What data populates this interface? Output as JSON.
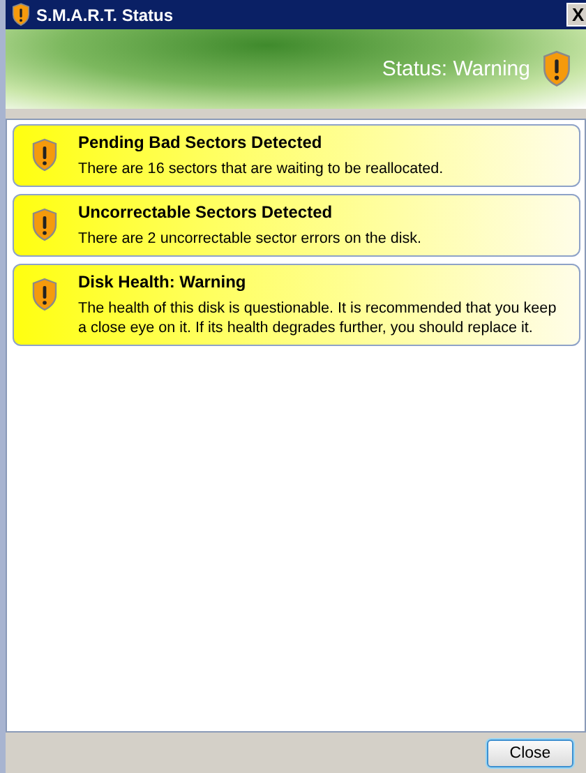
{
  "window": {
    "title": "S.M.A.R.T. Status",
    "close": "X"
  },
  "header": {
    "status": "Status: Warning"
  },
  "alerts": [
    {
      "title": "Pending Bad Sectors Detected",
      "message": "There are 16 sectors that are waiting to be reallocated."
    },
    {
      "title": "Uncorrectable Sectors Detected",
      "message": "There are 2 uncorrectable sector errors on the disk."
    },
    {
      "title": "Disk Health: Warning",
      "message": "The health of this disk is questionable. It is recommended that you keep a close eye on it. If its health degrades further, you should replace it."
    }
  ],
  "buttons": [
    "Close"
  ]
}
